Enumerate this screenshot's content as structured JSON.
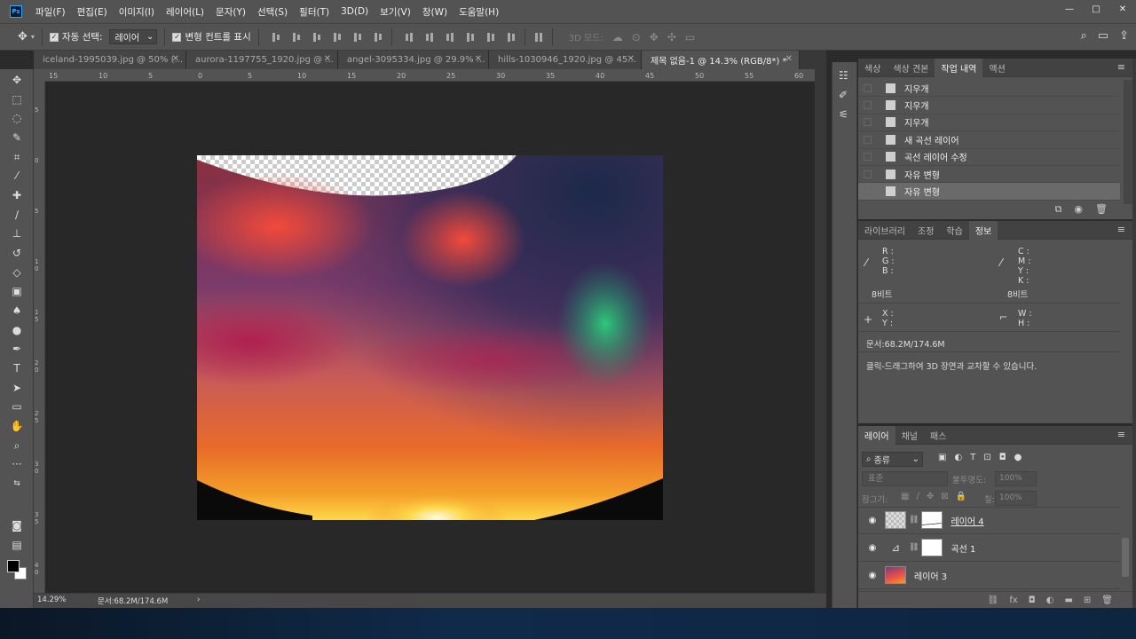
{
  "app": {
    "logo": "Ps"
  },
  "menu": [
    "파일(F)",
    "편집(E)",
    "이미지(I)",
    "레이어(L)",
    "문자(Y)",
    "선택(S)",
    "필터(T)",
    "3D(D)",
    "보기(V)",
    "창(W)",
    "도움말(H)"
  ],
  "window_controls": {
    "minimize": "—",
    "maximize": "□",
    "close": "✕"
  },
  "options": {
    "auto_select_label": "자동 선택:",
    "auto_select_value": "레이어",
    "transform_controls_label": "변형 컨트롤 표시",
    "mode_3d_label": "3D 모드:"
  },
  "tabs": [
    {
      "label": "iceland-1995039.jpg @ 50% (...",
      "active": false
    },
    {
      "label": "aurora-1197755_1920.jpg @ ...",
      "active": false
    },
    {
      "label": "angel-3095334.jpg @ 29.9% ...",
      "active": false
    },
    {
      "label": "hills-1030946_1920.jpg @ 45...",
      "active": false
    },
    {
      "label": "제목 없음-1 @ 14.3% (RGB/8*) *",
      "active": true
    }
  ],
  "ruler_h_labels": [
    "15",
    "10",
    "5",
    "0",
    "5",
    "10",
    "15",
    "20",
    "25",
    "30",
    "35",
    "40",
    "45",
    "50",
    "55",
    "60"
  ],
  "ruler_v_labels": [
    "5",
    "0",
    "5",
    "1 0",
    "1 5",
    "2 0",
    "2 5",
    "3 0",
    "3 5",
    "4 0"
  ],
  "status": {
    "zoom": "14.29%",
    "doc_size": "문서:68.2M/174.6M",
    "arrow": "›"
  },
  "history_panel": {
    "tabs": [
      {
        "label": "색상",
        "active": false
      },
      {
        "label": "색상 견본",
        "active": false
      },
      {
        "label": "작업 내역",
        "active": true
      },
      {
        "label": "액션",
        "active": false
      }
    ],
    "items": [
      {
        "label": "지우개",
        "icon": "eraser-icon",
        "selected": false
      },
      {
        "label": "지우개",
        "icon": "eraser-icon",
        "selected": false
      },
      {
        "label": "지우개",
        "icon": "eraser-icon",
        "selected": false
      },
      {
        "label": "새 곡선 레이어",
        "icon": "history-step-icon",
        "selected": false
      },
      {
        "label": "곡선 레이어 수정",
        "icon": "history-step-icon",
        "selected": false
      },
      {
        "label": "자유 변형",
        "icon": "history-step-icon",
        "selected": false
      },
      {
        "label": "자유 변형",
        "icon": "history-step-icon",
        "selected": true
      }
    ]
  },
  "info_panel": {
    "tabs": [
      {
        "label": "라이브러리",
        "active": false
      },
      {
        "label": "조정",
        "active": false
      },
      {
        "label": "학습",
        "active": false
      },
      {
        "label": "정보",
        "active": true
      }
    ],
    "rgb_labels": [
      "R :",
      "G :",
      "B :"
    ],
    "cmyk_labels": [
      "C :",
      "M :",
      "Y :",
      "K :"
    ],
    "bit_left": "8비트",
    "bit_right": "8비트",
    "xy_labels": [
      "X :",
      "Y :"
    ],
    "wh_labels": [
      "W :",
      "H :"
    ],
    "doc": "문서:68.2M/174.6M",
    "hint": "클릭-드래그하여 3D 장면과 교차할 수 있습니다."
  },
  "layers_panel": {
    "tabs": [
      {
        "label": "레이어",
        "active": true
      },
      {
        "label": "채널",
        "active": false
      },
      {
        "label": "패스",
        "active": false
      }
    ],
    "filter_label": "종류",
    "blend_mode": "표준",
    "opacity_label": "불투명도:",
    "opacity_value": "100%",
    "lock_label": "잠그기:",
    "fill_label": "칠:",
    "fill_value": "100%",
    "layers": [
      {
        "name": "레이어 4",
        "visible": true
      },
      {
        "name": "곡선 1",
        "visible": true
      },
      {
        "name": "레이어 3",
        "visible": true
      }
    ]
  },
  "colors": {
    "panel": "#535353",
    "canvas_bg": "#282828",
    "accent": "#31a8ff"
  }
}
